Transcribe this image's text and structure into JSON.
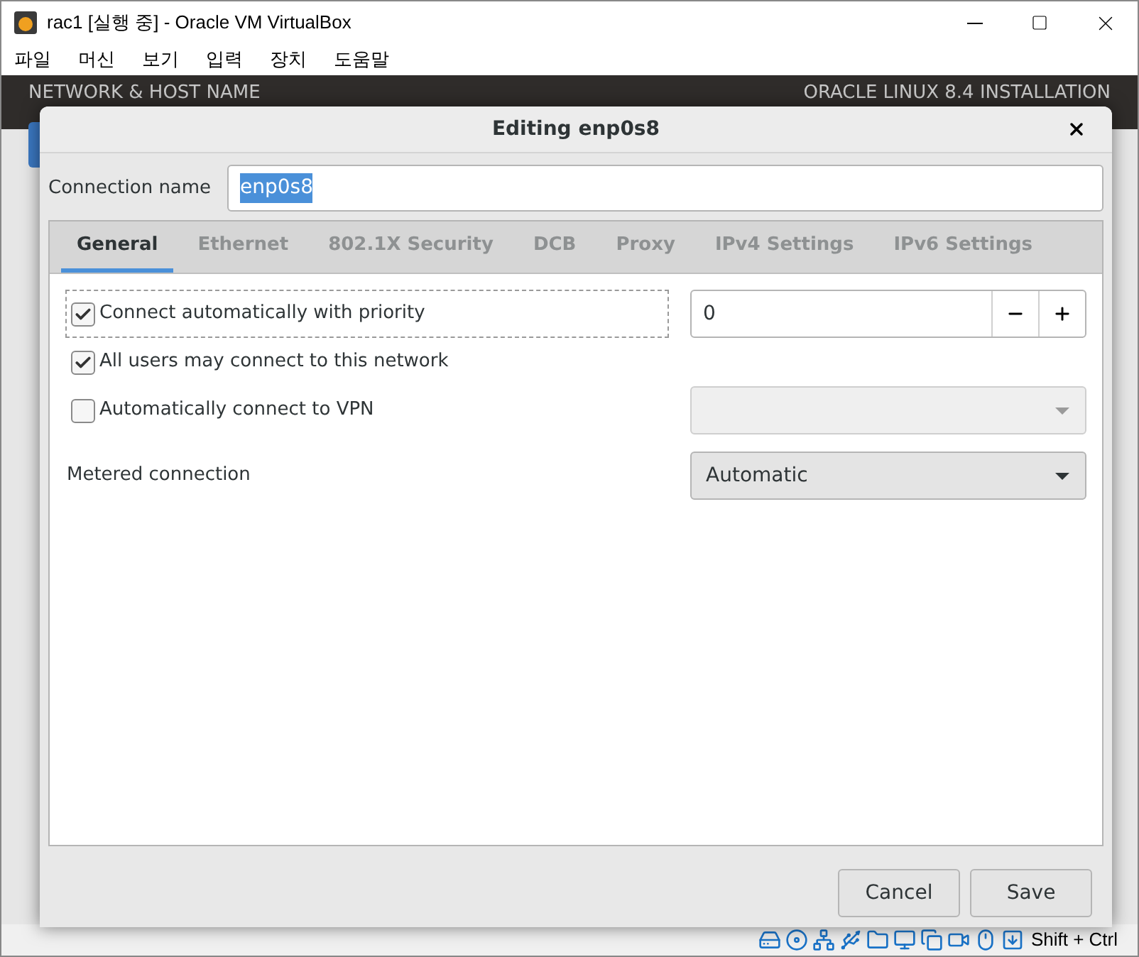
{
  "window": {
    "title": "rac1 [실행 중] - Oracle VM VirtualBox"
  },
  "menu": [
    "파일",
    "머신",
    "보기",
    "입력",
    "장치",
    "도움말"
  ],
  "installer": {
    "section_title": "NETWORK & HOST NAME",
    "product_title": "ORACLE LINUX 8.4 INSTALLATION"
  },
  "dialog": {
    "title": "Editing enp0s8",
    "connection_name": {
      "label": "Connection name",
      "value": "enp0s8",
      "text_selected": true
    },
    "tabs": [
      {
        "label": "General",
        "selected": true
      },
      {
        "label": "Ethernet",
        "selected": false
      },
      {
        "label": "802.1X Security",
        "selected": false
      },
      {
        "label": "DCB",
        "selected": false
      },
      {
        "label": "Proxy",
        "selected": false
      },
      {
        "label": "IPv4 Settings",
        "selected": false
      },
      {
        "label": "IPv6 Settings",
        "selected": false
      }
    ],
    "general": [
      {
        "kind": "checkbox-spin",
        "label": "Connect automatically with priority",
        "checked": true,
        "focused": true,
        "value": "0"
      },
      {
        "kind": "checkbox",
        "label": "All users may connect to this network",
        "checked": true,
        "focused": false
      },
      {
        "kind": "checkbox-dropdown",
        "label": "Automatically connect to VPN",
        "checked": false,
        "focused": false,
        "disabled": true
      },
      {
        "kind": "dropdown",
        "label": "Metered connection",
        "value": "Automatic",
        "disabled": false
      }
    ],
    "buttons": [
      "Cancel",
      "Save"
    ]
  },
  "status_bar": {
    "host_key": "Shift + Ctrl"
  }
}
